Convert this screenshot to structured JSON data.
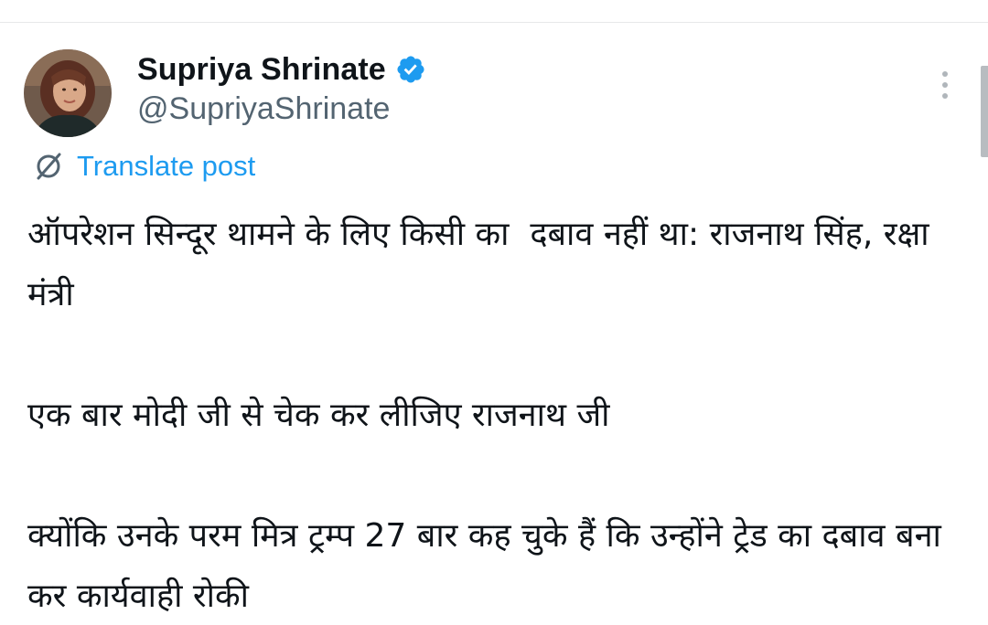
{
  "author": {
    "display_name": "Supriya Shrinate",
    "handle": "@SupriyaShrinate",
    "verified": true,
    "avatar_icon": "profile-photo"
  },
  "actions": {
    "more_icon": "vertical-ellipsis-icon",
    "translate_label": "Translate post",
    "translate_icon": "translate-globe-icon"
  },
  "post": {
    "paragraphs": [
      "ऑपरेशन सिन्दूर थामने के लिए किसी का  दबाव नहीं था: राजनाथ सिंह, रक्षा मंत्री",
      "एक बार मोदी जी से चेक कर लीजिए राजनाथ जी",
      "क्योंकि उनके परम मित्र ट्रम्प 27 बार कह चुके हैं कि उन्होंने ट्रेड का दबाव बना कर कार्यवाही रोकी"
    ]
  },
  "colors": {
    "accent": "#1d9bf0",
    "text_primary": "#0f1419",
    "text_secondary": "#536471",
    "divider": "#e7e9ea"
  }
}
